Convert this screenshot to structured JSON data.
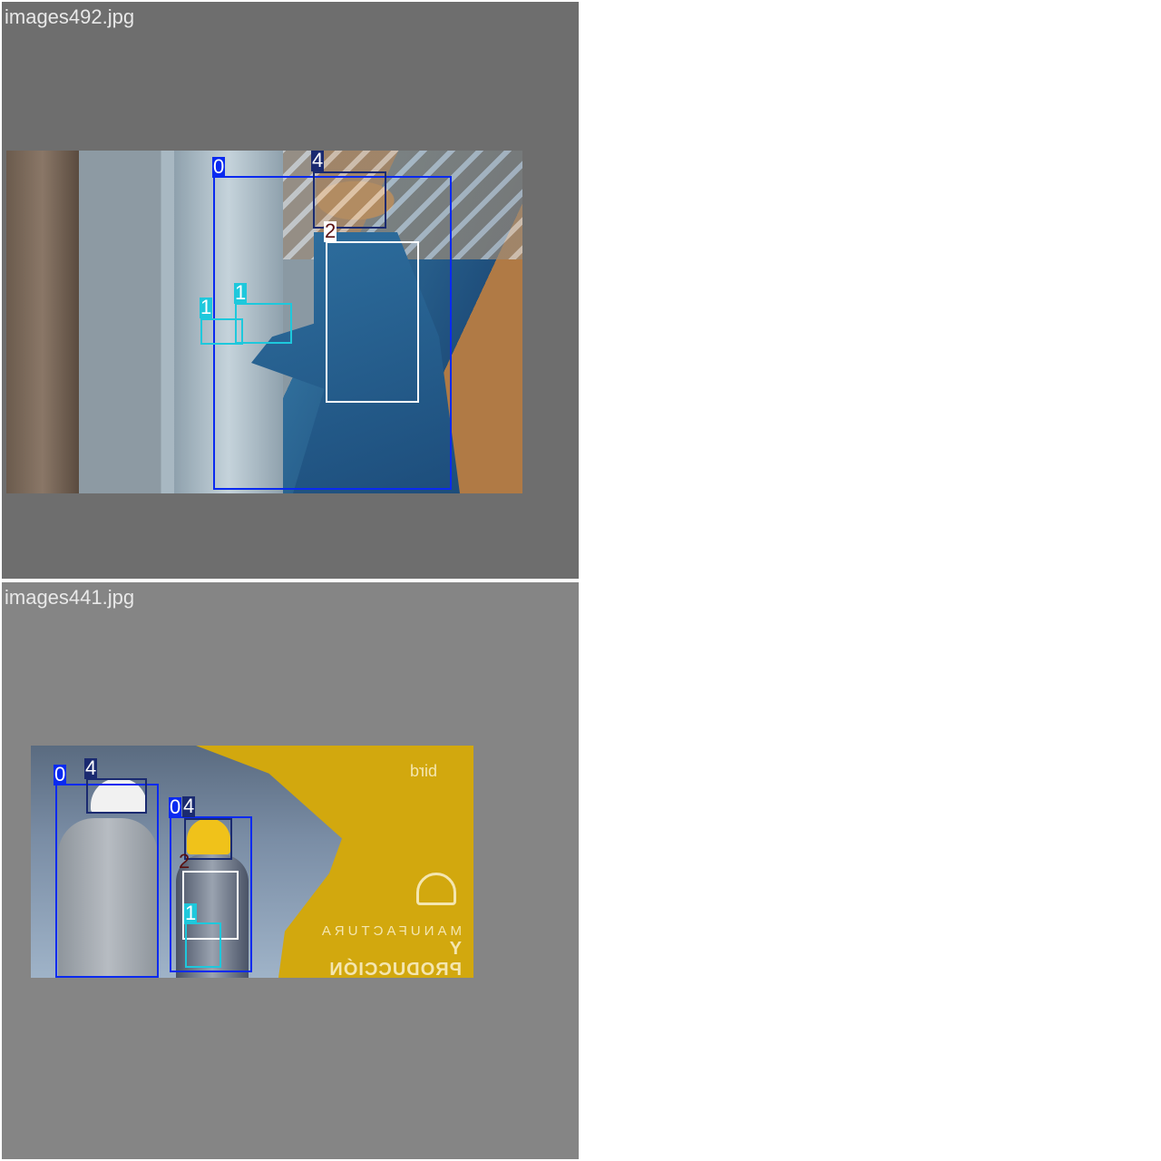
{
  "tiles": [
    {
      "filename": "images492.jpg",
      "background": "#6e6e6e",
      "labels": [
        "0",
        "4",
        "2",
        "1",
        "1"
      ]
    },
    {
      "filename": "images441.jpg",
      "background": "#858585",
      "labels": [
        "0",
        "4",
        "0",
        "4",
        "2",
        "1"
      ],
      "image_text": {
        "line1": "MANUFACTURA",
        "line2": "Y PRODUCCIÓN",
        "logo": "bird"
      }
    }
  ],
  "class_colors": {
    "0": "#0a2af0",
    "1": "#1ec8dc",
    "2": "#ffffff",
    "4": "#1a2a70"
  }
}
